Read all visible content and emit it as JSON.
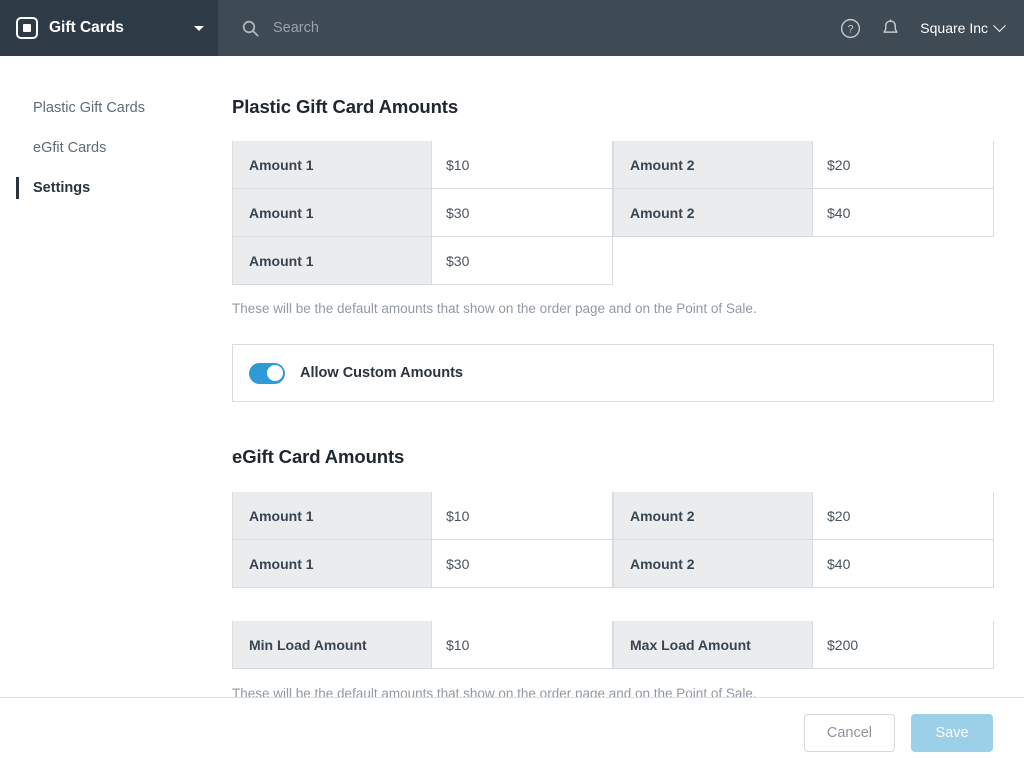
{
  "header": {
    "brand_name": "Gift Cards",
    "brand_logo_icon": "square-logo-icon",
    "brand_caret_icon": "caret-down-icon",
    "search_placeholder": "Search",
    "search_value": "",
    "search_icon": "search-icon",
    "help_icon": "help-circle-icon",
    "notifications_icon": "bell-icon",
    "account_name": "Square Inc",
    "account_caret_icon": "chevron-down-icon",
    "bg_color": "#3e4a54",
    "brand_bg_color": "#2e3a45"
  },
  "sidebar": {
    "items": [
      {
        "label": "Plastic Gift Cards",
        "active": false
      },
      {
        "label": "eGfit Cards",
        "active": false
      },
      {
        "label": "Settings",
        "active": true
      }
    ]
  },
  "main": {
    "plastic_section": {
      "title": "Plastic Gift Card Amounts",
      "rows": [
        {
          "label1": "Amount 1",
          "value1": "$10",
          "label2": "Amount 2",
          "value2": "$20"
        },
        {
          "label1": "Amount 1",
          "value1": "$30",
          "label2": "Amount 2",
          "value2": "$40"
        },
        {
          "label1": "Amount 1",
          "value1": "$30",
          "label2": "",
          "value2": ""
        }
      ],
      "helper_text": "These will be the default amounts that show on the order page and on the Point of Sale."
    },
    "custom_amounts_toggle": {
      "label": "Allow Custom Amounts",
      "state": "on",
      "accent_color": "#2e9bd6"
    },
    "egift_section": {
      "title": "eGift Card Amounts",
      "rows": [
        {
          "label1": "Amount 1",
          "value1": "$10",
          "label2": "Amount 2",
          "value2": "$20"
        },
        {
          "label1": "Amount 1",
          "value1": "$30",
          "label2": "Amount 2",
          "value2": "$40"
        }
      ],
      "load_rows": [
        {
          "label1": "Min Load Amount",
          "value1": "$10",
          "label2": "Max Load Amount",
          "value2": "$200"
        }
      ],
      "helper_text": "These will be the default amounts that show on the order page and on the Point of Sale."
    }
  },
  "footer": {
    "cancel_label": "Cancel",
    "save_label": "Save",
    "save_color": "#9ccfe8"
  }
}
